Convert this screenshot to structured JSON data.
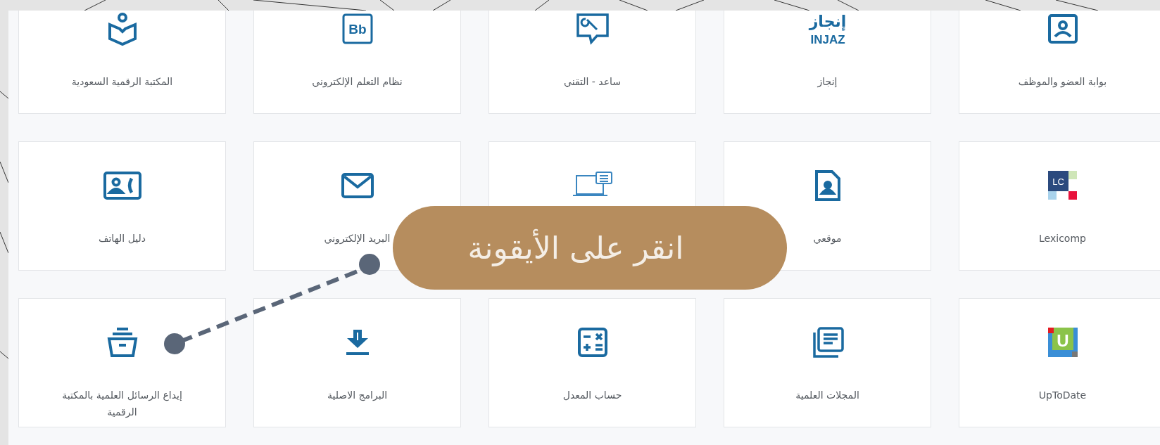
{
  "services": [
    {
      "kind": "portal",
      "label": "بوابة العضو والموظف"
    },
    {
      "kind": "injaz",
      "logo_text": [
        "إنجاز",
        "INJAZ"
      ],
      "label": "إنجاز"
    },
    {
      "kind": "support",
      "label": "ساعد - التقني"
    },
    {
      "kind": "blackboard",
      "logo_text": [
        "Bb"
      ],
      "label": "نظام التعلم الإلكتروني"
    },
    {
      "kind": "reader",
      "label": "المكتبة الرقمية السعودية"
    },
    {
      "kind": "lexicomp",
      "logo_text": [
        "LC"
      ],
      "label": "Lexicomp"
    },
    {
      "kind": "profile",
      "label": "موقعي"
    },
    {
      "kind": "chat"
    },
    {
      "kind": "mail",
      "label": "البريد الإلكتروني"
    },
    {
      "kind": "directory",
      "label": "دليل الهاتف"
    },
    {
      "kind": "uptodate",
      "logo_text": [
        "U"
      ],
      "label": "UpToDate"
    },
    {
      "kind": "journals",
      "label": "المجلات العلمية"
    },
    {
      "kind": "calculator",
      "label": "حساب المعدل"
    },
    {
      "kind": "download",
      "label": "البرامج الاصلية"
    },
    {
      "kind": "archive",
      "label": "إيداع الرسائل العلمية بالمكتبة الرقمية"
    }
  ],
  "callout": {
    "text": "انقر على الأيقونة"
  }
}
